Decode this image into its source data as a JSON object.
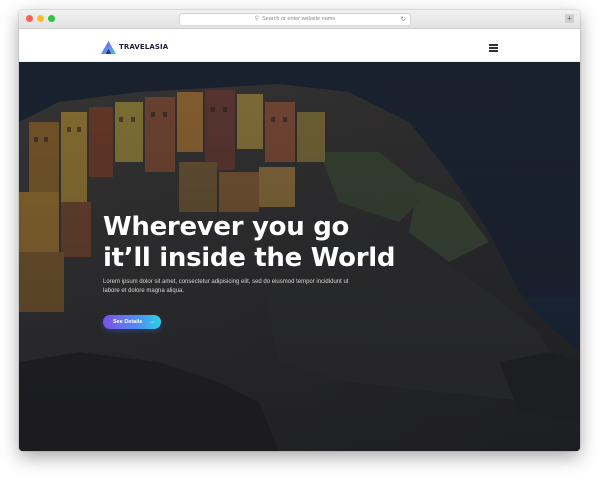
{
  "browser": {
    "url_placeholder": "Search or enter website name",
    "search_icon": "search-icon",
    "reload_icon": "reload-icon",
    "new_tab_symbol": "+"
  },
  "navbar": {
    "brand": "TRAVELASIA",
    "logo_icon": "triangle-logo-icon",
    "menu_icon": "hamburger-menu-icon"
  },
  "hero": {
    "title_line1": "Wherever you go",
    "title_line2": "it’ll inside the World",
    "description": "Lorem ipsum dolor sit amet, consectetur adipisicing elit, sed do eiusmod tempor incididunt ut labore et dolore magna aliqua.",
    "cta_label": "See Details",
    "cta_arrow": "→"
  },
  "colors": {
    "cta_gradient_start": "#7b4fe8",
    "cta_gradient_end": "#29d0e8",
    "overlay": "#1a1f2c",
    "brand_text": "#1d1d3a"
  }
}
